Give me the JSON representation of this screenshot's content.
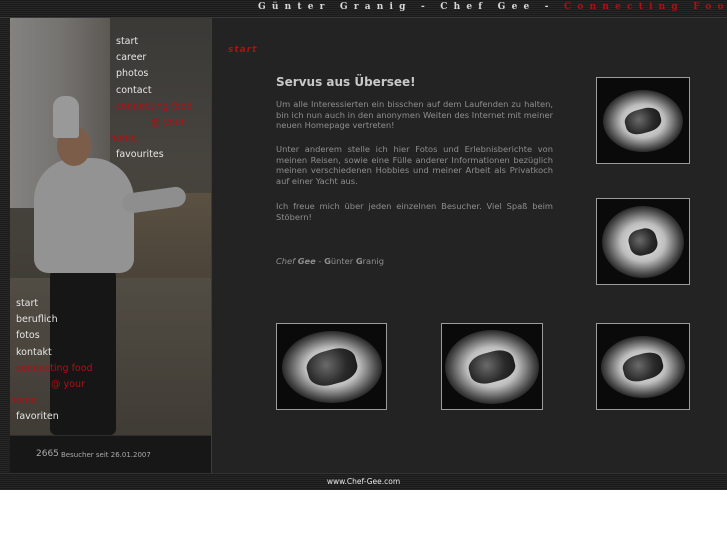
{
  "header": {
    "title_main": "Günter Granig - Chef Gee -",
    "title_accent": "Connecting Food"
  },
  "nav_en": [
    {
      "label": "start",
      "active": false
    },
    {
      "label": "career",
      "active": false
    },
    {
      "label": "photos",
      "active": false
    },
    {
      "label": "contact",
      "active": false
    },
    {
      "label": "connecting food",
      "active": true
    },
    {
      "label": "@ your",
      "active": true
    },
    {
      "label": "home",
      "active": true
    },
    {
      "label": "favourites",
      "active": false
    }
  ],
  "nav_de": [
    {
      "label": "start",
      "active": false
    },
    {
      "label": "beruflich",
      "active": false
    },
    {
      "label": "fotos",
      "active": false
    },
    {
      "label": "kontakt",
      "active": false
    },
    {
      "label": "connecting food",
      "active": true
    },
    {
      "label": "@ your",
      "active": true
    },
    {
      "label": "home",
      "active": true
    },
    {
      "label": "favoriten",
      "active": false
    }
  ],
  "counter": {
    "count": "2665",
    "label": "Besucher seit 26.01.2007"
  },
  "content": {
    "section_tag": "start",
    "heading": "Servus aus Übersee!",
    "paragraphs": [
      "Um alle Interessierten ein bisschen auf dem Laufenden zu halten, bin ich nun auch in den anonymen Weiten des Internet mit meiner neuen Homepage vertreten!",
      "Unter anderem stelle ich hier Fotos und Erlebnisberichte von meinen Reisen, sowie eine Fülle anderer Informationen bezüglich meinen verschiedenen Hobbies und meiner Arbeit als Privatkoch auf einer Yacht aus.",
      "Ich freue mich über jeden einzelnen Besucher. Viel Spaß beim Stöbern!"
    ],
    "signature": {
      "prefix": "Chef",
      "nick": "Gee",
      "dash": " - ",
      "first_initial": "G",
      "first_rest": "ünter",
      "last_initial": "G",
      "last_rest": "ranig"
    }
  },
  "footer": {
    "url": "www.Chef-Gee.com"
  }
}
